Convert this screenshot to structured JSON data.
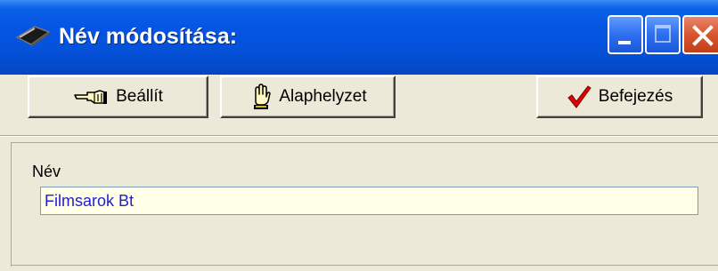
{
  "window": {
    "title": "Név módosítása:",
    "icon": "pen-icon",
    "controls": [
      "minimize-icon",
      "maximize-icon",
      "close-icon"
    ]
  },
  "toolbar": {
    "set": {
      "label": "Beállít",
      "icon": "pointing-hand-icon"
    },
    "reset": {
      "label": "Alaphelyzet",
      "icon": "raised-hand-icon"
    },
    "finish": {
      "label": "Befejezés",
      "icon": "red-checkmark-icon"
    }
  },
  "form": {
    "name_label": "Név",
    "name_value": "Filmsarok Bt"
  },
  "colors": {
    "titlebar": "#0554e3",
    "face": "#ece9d8",
    "input_bg": "#ffffe8",
    "input_text": "#2020d0",
    "check": "#e00000"
  }
}
